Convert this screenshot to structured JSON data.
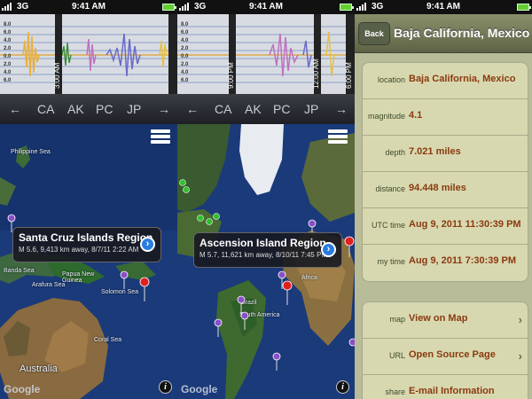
{
  "status_bar": {
    "network": "3G",
    "time": "9:41 AM"
  },
  "screen1": {
    "seismo": {
      "y_ticks": [
        "8.0",
        "6.0",
        "4.0",
        "2.0",
        "0.0",
        "2.0",
        "4.0",
        "6.0",
        "8.0"
      ],
      "time_markers": [
        "3:00 AM"
      ]
    },
    "filter": {
      "left_arrow": "←",
      "items": [
        "CA",
        "AK",
        "PC",
        "JP"
      ],
      "right_arrow": "→"
    },
    "map": {
      "labels": [
        "Philippine Sea",
        "Banda Sea",
        "Arafura Sea",
        "Papua New Guinea",
        "Solomon Sea",
        "Coral Sea",
        "Australia"
      ],
      "callout": {
        "title": "Santa Cruz Islands Region",
        "subtitle": "M 5.6, 9,413 km away, 8/7/11 2:22 AM"
      },
      "google": "Google"
    }
  },
  "screen2": {
    "seismo": {
      "y_ticks": [
        "8.0",
        "6.0",
        "4.0",
        "2.0",
        "0.0",
        "2.0",
        "4.0",
        "6.0",
        "8.0"
      ],
      "time_markers": [
        "9:00 PM",
        "12:00 AM",
        "6:00 PM"
      ]
    },
    "filter": {
      "left_arrow": "←",
      "items": [
        "CA",
        "AK",
        "PC",
        "JP"
      ],
      "right_arrow": "→"
    },
    "map": {
      "labels": [
        "Africa",
        "Brazil",
        "South America"
      ],
      "callout": {
        "title": "Ascension Island Region",
        "subtitle": "M 5.7, 11,621 km away, 8/10/11 7:45 PM"
      },
      "google": "Google"
    }
  },
  "screen3": {
    "nav": {
      "back": "Back",
      "title": "Baja California, Mexico"
    },
    "details": [
      {
        "key": "location",
        "value": "Baja California, Mexico"
      },
      {
        "key": "magnitude",
        "value": "4.1"
      },
      {
        "key": "depth",
        "value": "7.021 miles"
      },
      {
        "key": "distance",
        "value": "94.448 miles"
      },
      {
        "key": "UTC time",
        "value": "Aug 9, 2011 11:30:39 PM"
      },
      {
        "key": "my time",
        "value": "Aug 9, 2011 7:30:39 PM"
      }
    ],
    "actions": [
      {
        "key": "map",
        "value": "View on Map"
      },
      {
        "key": "URL",
        "value": "Open Source Page"
      },
      {
        "key": "share",
        "value": "E-mail Information"
      }
    ]
  },
  "colors": {
    "pin_purple": "#8a4fc8",
    "pin_red": "#e02020",
    "pin_green": "#2ec02e",
    "value_text": "#8a3a10"
  }
}
